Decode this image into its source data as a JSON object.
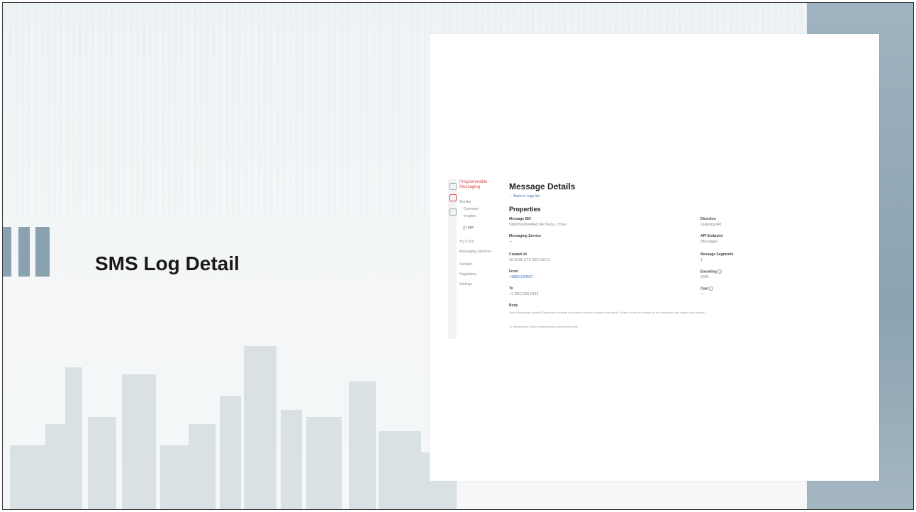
{
  "slide": {
    "title": "SMS Log Detail"
  },
  "colors": {
    "accent": "#8aa1b0",
    "brand": "#d04a4a",
    "link": "#3a6fb0"
  },
  "app": {
    "sidebar": {
      "brand": "Programmable Messaging",
      "section": "Monitor",
      "items": [
        "Overview",
        "Insights",
        "Logs",
        "Try it Out",
        "Messaging Services",
        "Senders",
        "Regulatory",
        "Settings"
      ]
    },
    "page_title": "Message Details",
    "back_link": "← Back to Logs list",
    "properties_title": "Properties",
    "fields": {
      "message_sid": {
        "label": "Message SID",
        "value": "SMa5f0a2beef4a574e79e2a...c7baa"
      },
      "direction": {
        "label": "Direction",
        "value": "Outgoing API"
      },
      "messaging_service": {
        "label": "Messaging Service",
        "value": "—"
      },
      "api_endpoint": {
        "label": "API Endpoint",
        "value": "/Messages"
      },
      "created_at": {
        "label": "Created At",
        "value": "19:16:06 UTC 2021-06-21"
      },
      "message_segments": {
        "label": "Message Segments",
        "value": "1"
      },
      "from": {
        "label": "From",
        "value": "+18551234567"
      },
      "encoding": {
        "label": "Encoding",
        "value": "GSM"
      },
      "to": {
        "label": "To",
        "value": "+1 (281) 555-0143"
      },
      "cost": {
        "label": "Cost",
        "value": "—"
      },
      "body": {
        "label": "Body",
        "line1": "Sent a frequently updated Dashboard showing your team's current progress and status. Please review the details on the dashboard and update your project...",
        "line2": "To unsubscribe: https://www.example.com/unsubscribe"
      }
    }
  }
}
